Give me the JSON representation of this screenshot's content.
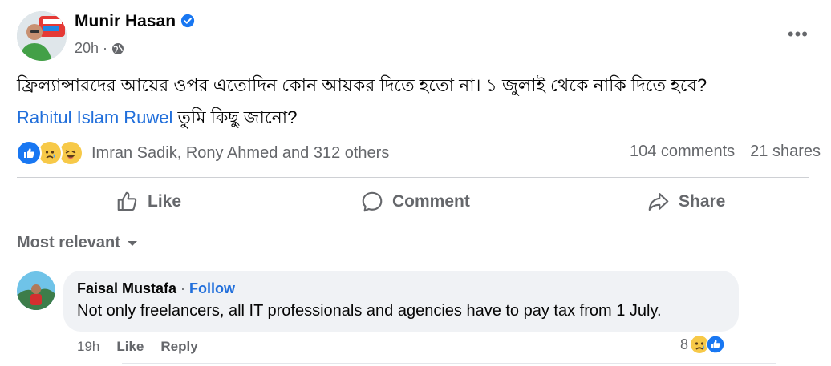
{
  "post": {
    "author": "Munir Hasan",
    "time": "20h",
    "text_line1": "ফ্রিল্যান্সারদের আয়ের ওপর এতোদিন কোন আয়কর দিতে হতো না। ১ জুলাই থেকে নাকি দিতে হবে?",
    "mention": "Rahitul Islam Ruwel",
    "text_line2": " তুমি কিছু জানো?",
    "reaction_names": "Imran Sadik, Rony Ahmed and 312 others",
    "comments_count": "104 comments",
    "shares_count": "21 shares"
  },
  "actions": {
    "like": "Like",
    "comment": "Comment",
    "share": "Share"
  },
  "filter": {
    "label": "Most relevant"
  },
  "comment": {
    "author": "Faisal Mustafa",
    "separator": " · ",
    "follow": "Follow",
    "text": "Not only freelancers, all IT professionals and agencies have to pay tax from 1 July.",
    "time": "19h",
    "like": "Like",
    "reply": "Reply",
    "reaction_count": "8"
  },
  "colors": {
    "link": "#216fdb",
    "like_blue": "#1877f2",
    "muted": "#65676b",
    "bubble": "#f0f2f5",
    "emoji_yellow": "#f7c948"
  },
  "icons": [
    "verified-badge-icon",
    "globe-icon",
    "more-options-icon",
    "like-reaction-icon",
    "sad-reaction-icon",
    "haha-reaction-icon",
    "like-outline-icon",
    "comment-outline-icon",
    "share-outline-icon",
    "chevron-down-icon"
  ]
}
